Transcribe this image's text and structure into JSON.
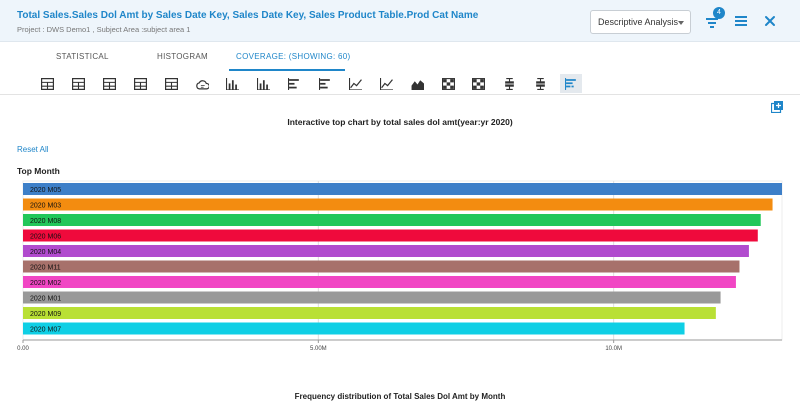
{
  "header": {
    "title": "Total Sales.Sales Dol Amt by Sales Date Key, Sales Date Key, Sales Product Table.Prod Cat Name",
    "subtitle": "Project : DWS Demo1 ,  Subject Area :subject area 1",
    "analysis_select": "Descriptive Analysis",
    "filter_badge": "4",
    "colors": {
      "accent": "#1f86c9",
      "header_bg": "#eef5fb"
    }
  },
  "tabs": [
    {
      "label": "STATISTICAL",
      "active": false
    },
    {
      "label": "HISTOGRAM",
      "active": false
    },
    {
      "label": "COVERAGE: (SHOWING: 60)",
      "active": true
    }
  ],
  "toolbar": {
    "icons": [
      "table-icon",
      "table-icon",
      "table-icon",
      "table-icon",
      "table-icon",
      "cloud-icon",
      "bar-chart-icon",
      "bar-chart-icon",
      "horizontal-bar-icon",
      "horizontal-bar-icon",
      "line-chart-icon",
      "line-chart-icon",
      "area-chart-icon",
      "heatmap-icon",
      "heatmap-icon",
      "box-plot-icon",
      "box-plot-icon",
      "top-chart-icon"
    ],
    "active_index": 17
  },
  "main": {
    "chart_title": "Interactive top chart by total sales dol amt(year:yr 2020)",
    "reset_label": "Reset All",
    "section_label": "Top Month",
    "frequency_title": "Frequency distribution of Total Sales Dol Amt by Month"
  },
  "chart_data": {
    "type": "bar",
    "orientation": "horizontal",
    "categories": [
      "2020 M05",
      "2020 M03",
      "2020 M08",
      "2020 M06",
      "2020 M04",
      "2020 M11",
      "2020 M02",
      "2020 M01",
      "2020 M09",
      "2020 M07"
    ],
    "values": [
      12850000,
      12690000,
      12490000,
      12440000,
      12290000,
      12130000,
      12070000,
      11810000,
      11730000,
      11200000
    ],
    "colors": [
      "#3d7fc8",
      "#f38c10",
      "#22c75a",
      "#ef0a3c",
      "#b14bce",
      "#a7716b",
      "#f146c4",
      "#999999",
      "#b9e035",
      "#0fcfe5"
    ],
    "xlim": [
      0,
      12850000
    ],
    "x_ticks": [
      "0.00",
      "5.00M",
      "10.0M"
    ],
    "x_tick_values": [
      0,
      5000000,
      10000000
    ],
    "grid": true
  }
}
